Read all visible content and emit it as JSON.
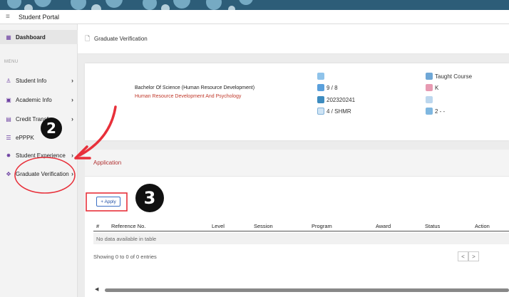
{
  "app": {
    "title": "Student Portal"
  },
  "sidebar": {
    "menu_heading": "MENU",
    "items": [
      {
        "label": "Dashboard",
        "icon": "grid-icon",
        "active": true
      },
      {
        "label": "Student Info",
        "icon": "user-icon"
      },
      {
        "label": "Academic Info",
        "icon": "calendar-icon"
      },
      {
        "label": "Credit Transfer",
        "icon": "document-icon"
      },
      {
        "label": "ePPPK",
        "icon": "list-icon"
      },
      {
        "label": "Student Experience",
        "icon": "star-icon"
      },
      {
        "label": "Graduate Verification",
        "icon": "puzzle-icon"
      }
    ]
  },
  "page": {
    "title": "Graduate Verification"
  },
  "program": {
    "name": "Bachelor Of Science (Human Resource Development)",
    "faculty": "Human Resource Development And Psychology",
    "col1": [
      "",
      "9 / 8",
      "202320241",
      "4 / SHMR"
    ],
    "col2": [
      "Taught Course",
      "K",
      "",
      "2 - -"
    ]
  },
  "application": {
    "heading": "Application",
    "apply_label": "+ Apply",
    "columns": [
      "#",
      "Reference No.",
      "Level",
      "Session",
      "Program",
      "Award",
      "Status",
      "Action"
    ],
    "empty_text": "No data available in table",
    "showing_text": "Showing 0 to 0 of 0 entries",
    "prev": "<",
    "next": ">"
  },
  "annotations": {
    "step2": "2",
    "step3": "3"
  },
  "colors": {
    "accent_blue": "#3b6fc4",
    "annotation_red": "#e8303a",
    "faculty_red": "#c0392b",
    "header_teal": "#2d5d78"
  }
}
